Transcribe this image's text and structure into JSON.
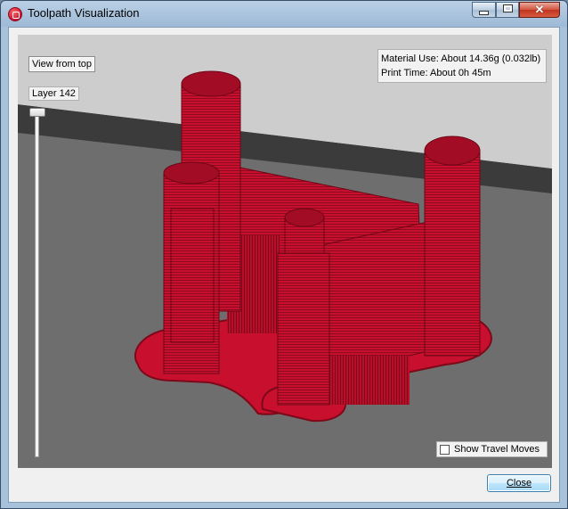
{
  "window": {
    "title": "Toolpath Visualization",
    "icon": "makerbot-logo-icon",
    "controls": [
      "minimize-icon",
      "maximize-icon",
      "close-icon"
    ]
  },
  "viewport": {
    "view_from_top_label": "View from top",
    "layer_label": "Layer 142",
    "material_use": "Material Use: About 14.36g (0.032lb)",
    "print_time": "Print Time: About 0h 45m",
    "show_travel_moves_label": "Show Travel Moves",
    "show_travel_moves_checked": false,
    "model_color": "#c8102e"
  },
  "footer": {
    "close_label": "Close"
  }
}
